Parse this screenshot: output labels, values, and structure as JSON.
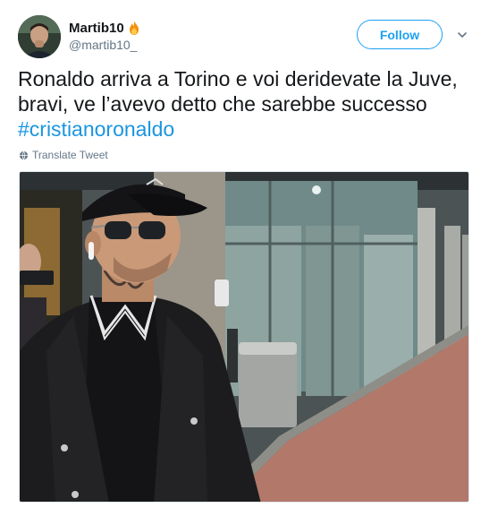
{
  "user": {
    "display_name": "Martib10",
    "handle": "@martib10_",
    "badge_emoji": "fire-icon"
  },
  "actions": {
    "follow_label": "Follow",
    "menu_icon": "chevron-down-icon"
  },
  "tweet": {
    "text_line": "Ronaldo arriva a Torino e voi deridevate la Juve, bravi, ve l’avevo detto che sarebbe successo ",
    "hashtag": "#cristianoronaldo"
  },
  "translate": {
    "label": "Translate Tweet",
    "icon": "globe-icon"
  },
  "colors": {
    "accent": "#1da1f2",
    "hashtag": "#1b95e0",
    "secondary_text": "#657786"
  }
}
